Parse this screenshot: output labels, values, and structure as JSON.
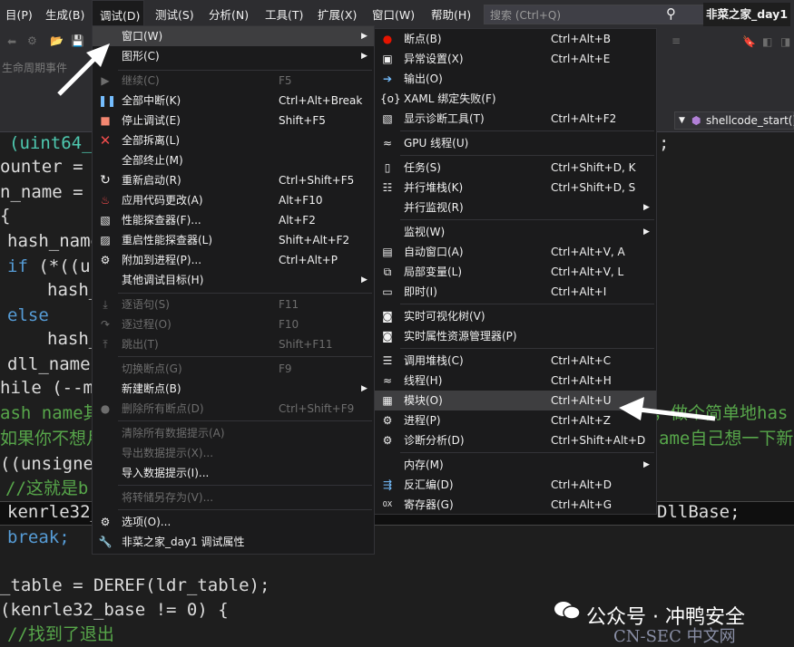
{
  "menubar": {
    "items": [
      "目(P)",
      "生成(B)",
      "调试(D)",
      "测试(S)",
      "分析(N)",
      "工具(T)",
      "扩展(X)",
      "窗口(W)",
      "帮助(H)"
    ],
    "search_placeholder": "搜索 (Ctrl+Q)",
    "solution_name": "非菜之家_day1"
  },
  "toolbar": {
    "lifecycle_label": "生命周期事件"
  },
  "editor": {
    "function_dropdown": "shellcode_start()"
  },
  "code": {
    "l1a": "(uint64_t",
    "l1b": ";",
    "l2": "ounter = ",
    "l3": "n_name = (",
    "l4": "{",
    "l5": "hash_name",
    "l6a": "if",
    "l6b": " (*((un",
    "l7": "hash_",
    "l8": "else",
    "l9": "hash_",
    "l10": "dll_name-",
    "l11": "hile (--m",
    "l12a": "ash name其",
    "l12b": "，做个简单地has",
    "l13a": "如果你不想月",
    "l13b": "ame自己想一下新",
    "l14": "((unsigned",
    "l15": "//这就是b",
    "l16a": "kenrle32_",
    "l16b": "DllBase;",
    "l17": "break;",
    "l18": "_table = DEREF(ldr_table);",
    "l19": "(kenrle32_base != 0) {",
    "l20": "//找到了退出"
  },
  "debug_menu": {
    "items": [
      {
        "label": "窗口(W)",
        "shortcut": "",
        "icon": "none"
      },
      {
        "label": "图形(C)",
        "shortcut": "",
        "icon": "none"
      },
      {
        "label": "继续(C)",
        "shortcut": "F5",
        "icon": "play-icon"
      },
      {
        "label": "全部中断(K)",
        "shortcut": "Ctrl+Alt+Break",
        "icon": "pause-icon"
      },
      {
        "label": "停止调试(E)",
        "shortcut": "Shift+F5",
        "icon": "stop-icon"
      },
      {
        "label": "全部拆离(L)",
        "shortcut": "",
        "icon": "detach-x-icon"
      },
      {
        "label": "全部终止(M)",
        "shortcut": "",
        "icon": "none"
      },
      {
        "label": "重新启动(R)",
        "shortcut": "Ctrl+Shift+F5",
        "icon": "restart-icon"
      },
      {
        "label": "应用代码更改(A)",
        "shortcut": "Alt+F10",
        "icon": "flame-icon"
      },
      {
        "label": "性能探查器(F)...",
        "shortcut": "Alt+F2",
        "icon": "profiler-icon"
      },
      {
        "label": "重启性能探查器(L)",
        "shortcut": "Shift+Alt+F2",
        "icon": "profiler-restart-icon"
      },
      {
        "label": "附加到进程(P)...",
        "shortcut": "Ctrl+Alt+P",
        "icon": "attach-gear-icon"
      },
      {
        "label": "其他调试目标(H)",
        "shortcut": "",
        "icon": "none"
      },
      {
        "label": "逐语句(S)",
        "shortcut": "F11",
        "icon": "step-into-icon"
      },
      {
        "label": "逐过程(O)",
        "shortcut": "F10",
        "icon": "step-over-icon"
      },
      {
        "label": "跳出(T)",
        "shortcut": "Shift+F11",
        "icon": "step-out-icon"
      },
      {
        "label": "切换断点(G)",
        "shortcut": "F9",
        "icon": "none"
      },
      {
        "label": "新建断点(B)",
        "shortcut": "",
        "icon": "none"
      },
      {
        "label": "删除所有断点(D)",
        "shortcut": "Ctrl+Shift+F9",
        "icon": "delete-breakpoints-icon"
      },
      {
        "label": "清除所有数据提示(A)",
        "shortcut": "",
        "icon": "none"
      },
      {
        "label": "导出数据提示(X)...",
        "shortcut": "",
        "icon": "none"
      },
      {
        "label": "导入数据提示(I)...",
        "shortcut": "",
        "icon": "none"
      },
      {
        "label": "将转储另存为(V)...",
        "shortcut": "",
        "icon": "none"
      },
      {
        "label": "选项(O)...",
        "shortcut": "",
        "icon": "gear-icon"
      },
      {
        "label": "非菜之家_day1 调试属性",
        "shortcut": "",
        "icon": "wrench-icon"
      }
    ]
  },
  "window_submenu": {
    "items": [
      {
        "label": "断点(B)",
        "shortcut": "Ctrl+Alt+B",
        "icon": "breakpoint-icon"
      },
      {
        "label": "异常设置(X)",
        "shortcut": "Ctrl+Alt+E",
        "icon": "exception-settings-icon"
      },
      {
        "label": "输出(O)",
        "shortcut": "",
        "icon": "output-icon"
      },
      {
        "label": "XAML 绑定失败(F)",
        "shortcut": "",
        "icon": "xaml-binding-icon"
      },
      {
        "label": "显示诊断工具(T)",
        "shortcut": "Ctrl+Alt+F2",
        "icon": "diagnostic-tools-icon"
      },
      {
        "label": "GPU 线程(U)",
        "shortcut": "",
        "icon": "gpu-threads-icon"
      },
      {
        "label": "任务(S)",
        "shortcut": "Ctrl+Shift+D, K",
        "icon": "tasks-icon"
      },
      {
        "label": "并行堆栈(K)",
        "shortcut": "Ctrl+Shift+D, S",
        "icon": "parallel-stacks-icon"
      },
      {
        "label": "并行监视(R)",
        "shortcut": "",
        "icon": "none"
      },
      {
        "label": "监视(W)",
        "shortcut": "",
        "icon": "none"
      },
      {
        "label": "自动窗口(A)",
        "shortcut": "Ctrl+Alt+V, A",
        "icon": "autos-icon"
      },
      {
        "label": "局部变量(L)",
        "shortcut": "Ctrl+Alt+V, L",
        "icon": "locals-icon"
      },
      {
        "label": "即时(I)",
        "shortcut": "Ctrl+Alt+I",
        "icon": "immediate-icon"
      },
      {
        "label": "实时可视化树(V)",
        "shortcut": "",
        "icon": "camera-icon"
      },
      {
        "label": "实时属性资源管理器(P)",
        "shortcut": "",
        "icon": "camera-icon"
      },
      {
        "label": "调用堆栈(C)",
        "shortcut": "Ctrl+Alt+C",
        "icon": "call-stack-icon"
      },
      {
        "label": "线程(H)",
        "shortcut": "Ctrl+Alt+H",
        "icon": "threads-icon"
      },
      {
        "label": "模块(O)",
        "shortcut": "Ctrl+Alt+U",
        "icon": "modules-icon"
      },
      {
        "label": "进程(P)",
        "shortcut": "Ctrl+Alt+Z",
        "icon": "processes-icon"
      },
      {
        "label": "诊断分析(D)",
        "shortcut": "Ctrl+Shift+Alt+D",
        "icon": "diagnostic-analysis-icon"
      },
      {
        "label": "内存(M)",
        "shortcut": "",
        "icon": "none"
      },
      {
        "label": "反汇编(D)",
        "shortcut": "Ctrl+Alt+D",
        "icon": "disassembly-icon"
      },
      {
        "label": "寄存器(G)",
        "shortcut": "Ctrl+Alt+G",
        "icon": "registers-icon"
      }
    ]
  },
  "watermark": {
    "brand": "公众号 · 冲鸭安全",
    "site": "CN-SEC 中文网"
  }
}
